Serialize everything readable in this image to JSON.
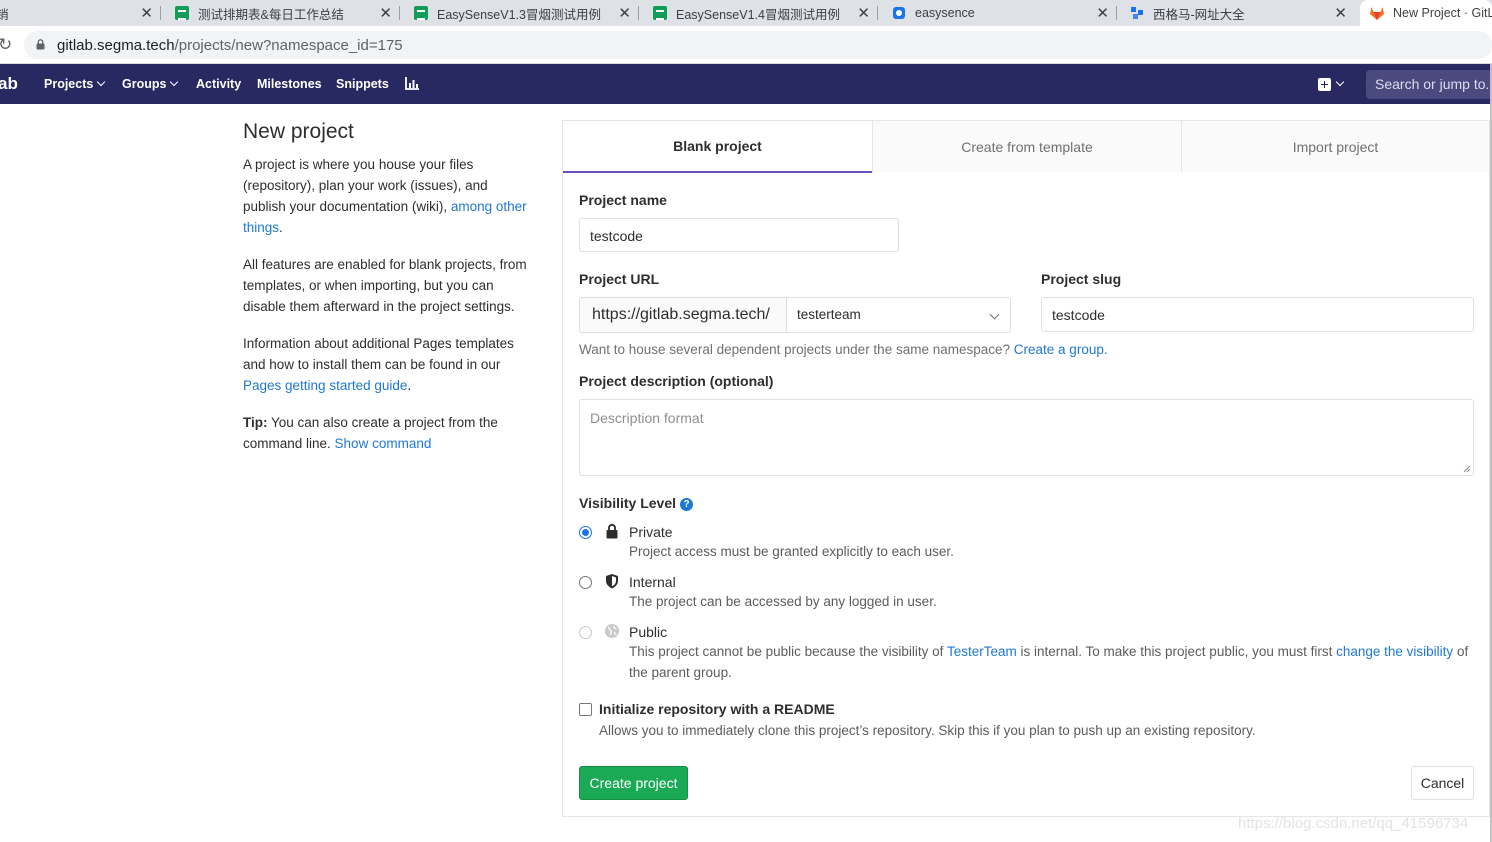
{
  "browser": {
    "tabs": [
      {
        "title": "销",
        "favicon": "doc-icon"
      },
      {
        "title": "测试排期表&每日工作总结",
        "favicon": "sheets-icon"
      },
      {
        "title": "EasySenseV1.3冒烟测试用例",
        "favicon": "sheets-icon"
      },
      {
        "title": "EasySenseV1.4冒烟测试用例",
        "favicon": "sheets-icon"
      },
      {
        "title": "easysence",
        "favicon": "app-icon"
      },
      {
        "title": "西格马-网址大全",
        "favicon": "app-icon"
      },
      {
        "title": "New Project · GitL",
        "favicon": "gitlab-icon"
      }
    ],
    "url_host": "gitlab.segma.tech",
    "url_path": "/projects/new?namespace_id=175"
  },
  "nav": {
    "logo_text": "ab",
    "items": [
      "Projects",
      "Groups",
      "Activity",
      "Milestones",
      "Snippets"
    ],
    "search_placeholder": "Search or jump to..."
  },
  "intro": {
    "title": "New project",
    "p1_text": "A project is where you house your files (repository), plan your work (issues), and publish your documentation (wiki), ",
    "p1_link": "among other things",
    "p1_end": ".",
    "p2": "All features are enabled for blank projects, from templates, or when importing, but you can disable them afterward in the project settings.",
    "p3_text": "Information about additional Pages templates and how to install them can be found in our ",
    "p3_link": "Pages getting started guide",
    "p3_end": ".",
    "tip_label": "Tip:",
    "tip_text": " You can also create a project from the command line. ",
    "tip_link": "Show command"
  },
  "tabs": [
    "Blank project",
    "Create from template",
    "Import project"
  ],
  "form": {
    "name_label": "Project name",
    "name_value": "testcode",
    "url_label": "Project URL",
    "url_prefix": "https://gitlab.segma.tech/",
    "namespace_value": "testerteam",
    "slug_label": "Project slug",
    "slug_value": "testcode",
    "namespace_help": "Want to house several dependent projects under the same namespace? ",
    "namespace_help_link": "Create a group.",
    "desc_label": "Project description (optional)",
    "desc_placeholder": "Description format",
    "visibility_label": "Visibility Level",
    "visibility": [
      {
        "title": "Private",
        "desc": "Project access must be granted explicitly to each user.",
        "icon": "lock-icon",
        "checked": true
      },
      {
        "title": "Internal",
        "desc": "The project can be accessed by any logged in user.",
        "icon": "shield-icon",
        "checked": false
      },
      {
        "title": "Public",
        "desc": "This project cannot be public because the visibility of ",
        "icon": "globe-icon",
        "checked": false,
        "desc_link1": "TesterTeam",
        "desc_mid": " is internal. To make this project public, you must first ",
        "desc_link2": "change the visibility",
        "desc_end": " of the parent group."
      }
    ],
    "readme_label": "Initialize repository with a README",
    "readme_help": "Allows you to immediately clone this project’s repository. Skip this if you plan to push up an existing repository.",
    "create_button": "Create project",
    "cancel_button": "Cancel"
  },
  "watermark": "https://blog.csdn.net/qq_41596734",
  "colors": {
    "nav_bg": "#292961",
    "link": "#1f78d1",
    "success": "#1aaa55",
    "tab_active": "#6b4fbb"
  }
}
